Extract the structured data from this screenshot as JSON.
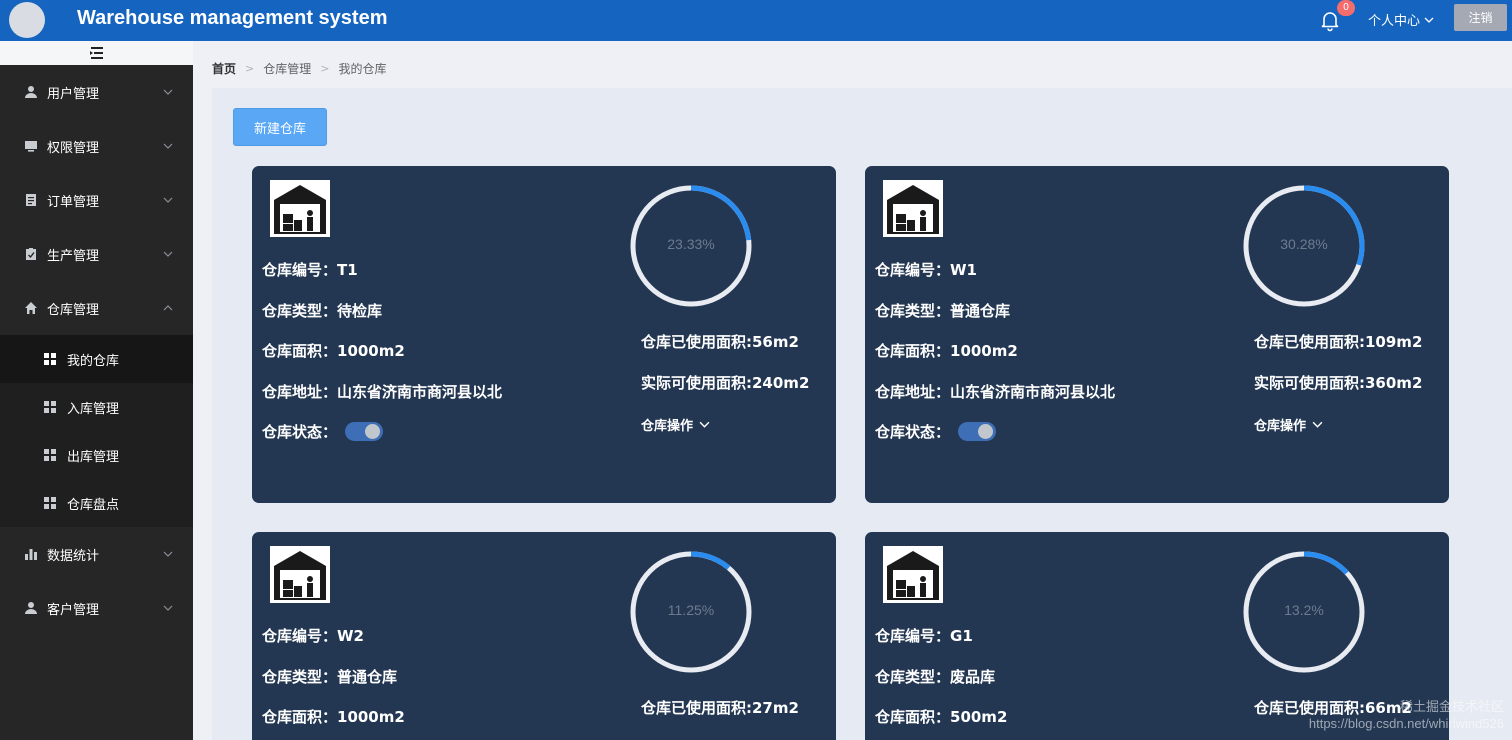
{
  "header": {
    "title": "Warehouse management system",
    "notification_count": "0",
    "user_center_label": "个人中心",
    "logout_label": "注销"
  },
  "sidebar": {
    "menu": [
      {
        "label": "用户管理",
        "icon": "user-icon"
      },
      {
        "label": "权限管理",
        "icon": "monitor-icon"
      },
      {
        "label": "订单管理",
        "icon": "document-icon"
      },
      {
        "label": "生产管理",
        "icon": "clipboard-check-icon"
      },
      {
        "label": "仓库管理",
        "icon": "home-icon"
      }
    ],
    "submenu": [
      {
        "label": "我的仓库",
        "icon": "grid-icon"
      },
      {
        "label": "入库管理",
        "icon": "grid-icon"
      },
      {
        "label": "出库管理",
        "icon": "grid-icon"
      },
      {
        "label": "仓库盘点",
        "icon": "grid-icon"
      }
    ],
    "menu_after": [
      {
        "label": "数据统计",
        "icon": "bar-chart-icon"
      },
      {
        "label": "客户管理",
        "icon": "user-icon"
      }
    ]
  },
  "breadcrumb": [
    "首页",
    "仓库管理",
    "我的仓库"
  ],
  "toolbar": {
    "new_warehouse_label": "新建仓库"
  },
  "warehouses": [
    {
      "code": "仓库编号：T1",
      "type": "仓库类型：待检库",
      "area": "仓库面积：1000m2",
      "address": "仓库地址：山东省济南市商河县以北",
      "status_label": "仓库状态：",
      "status_on": true,
      "usage_percent": 23.33,
      "usage_text": "23.33%",
      "used_area": "仓库已使用面积:56m2",
      "available_area": "实际可使用面积:240m2",
      "ops_label": "仓库操作"
    },
    {
      "code": "仓库编号：W1",
      "type": "仓库类型：普通仓库",
      "area": "仓库面积：1000m2",
      "address": "仓库地址：山东省济南市商河县以北",
      "status_label": "仓库状态：",
      "status_on": true,
      "usage_percent": 30.28,
      "usage_text": "30.28%",
      "used_area": "仓库已使用面积:109m2",
      "available_area": "实际可使用面积:360m2",
      "ops_label": "仓库操作"
    },
    {
      "code": "仓库编号：W2",
      "type": "仓库类型：普通仓库",
      "area": "仓库面积：1000m2",
      "usage_percent": 11.25,
      "usage_text": "11.25%",
      "used_area": "仓库已使用面积:27m2"
    },
    {
      "code": "仓库编号：G1",
      "type": "仓库类型：废品库",
      "area": "仓库面积：500m2",
      "usage_percent": 13.2,
      "usage_text": "13.2%",
      "used_area": "仓库已使用面积:66m2"
    }
  ],
  "watermark": {
    "line1": "稀土掘金技术社区",
    "line2": "https://blog.csdn.net/whirlwind526"
  },
  "colors": {
    "header": "#1565c0",
    "sidebar": "#262626",
    "card": "#243752",
    "ring_track": "#e8ecf2",
    "ring_progress": "#2b8cf0",
    "primary_button": "#5aa7f5"
  }
}
